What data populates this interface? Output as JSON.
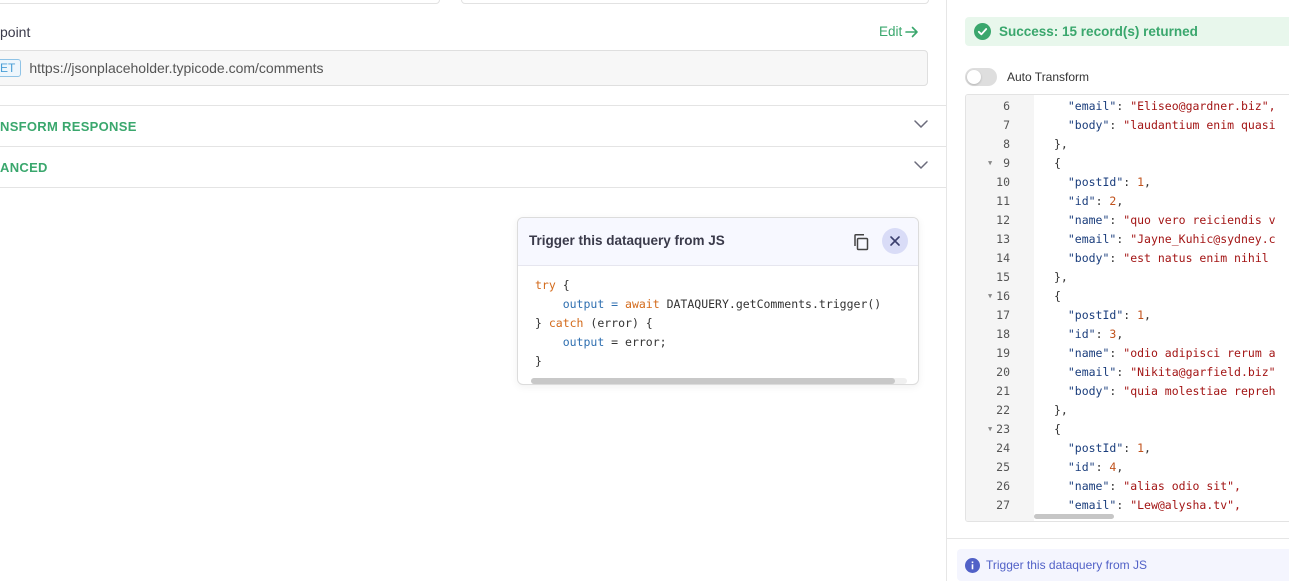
{
  "endpoint": {
    "label": "point",
    "edit_label": "Edit",
    "method": "ET",
    "url": "https://jsonplaceholder.typicode.com/comments"
  },
  "sections": [
    {
      "title": "NSFORM RESPONSE"
    },
    {
      "title": "ANCED"
    }
  ],
  "popup": {
    "title": "Trigger this dataquery from JS",
    "code": {
      "l1_kw": "try",
      "l1_rest": " {",
      "l2_var": "output",
      "l2_eq": " = ",
      "l2_kw": "await",
      "l2_rest": " DATAQUERY.getComments.trigger()",
      "l3_open": "} ",
      "l3_kw": "catch",
      "l3_rest": " (error) {",
      "l4_var": "output",
      "l4_rest": " = error;",
      "l5": "}"
    }
  },
  "result": {
    "status": "Success: 15 record(s) returned",
    "auto_transform_label": "Auto Transform",
    "auto_transform_on": false,
    "info_text": "Trigger this dataquery from JS"
  },
  "editor_lines": [
    {
      "n": "6",
      "fold": false,
      "indent": "  ",
      "key": "\"email\"",
      "sep": ": ",
      "val": "\"Eliseo@gardner.biz\",",
      "vt": "s"
    },
    {
      "n": "7",
      "fold": false,
      "indent": "  ",
      "key": "\"body\"",
      "sep": ": ",
      "val": "\"laudantium enim quasi",
      "vt": "s"
    },
    {
      "n": "8",
      "fold": false,
      "indent": "",
      "key": "",
      "sep": "",
      "val": "},",
      "vt": "p"
    },
    {
      "n": "9",
      "fold": true,
      "indent": "",
      "key": "",
      "sep": "",
      "val": "{",
      "vt": "p"
    },
    {
      "n": "10",
      "fold": false,
      "indent": "  ",
      "key": "\"postId\"",
      "sep": ": ",
      "val": "1",
      "tail": ",",
      "vt": "n"
    },
    {
      "n": "11",
      "fold": false,
      "indent": "  ",
      "key": "\"id\"",
      "sep": ": ",
      "val": "2",
      "tail": ",",
      "vt": "n"
    },
    {
      "n": "12",
      "fold": false,
      "indent": "  ",
      "key": "\"name\"",
      "sep": ": ",
      "val": "\"quo vero reiciendis v",
      "vt": "s"
    },
    {
      "n": "13",
      "fold": false,
      "indent": "  ",
      "key": "\"email\"",
      "sep": ": ",
      "val": "\"Jayne_Kuhic@sydney.c",
      "vt": "s"
    },
    {
      "n": "14",
      "fold": false,
      "indent": "  ",
      "key": "\"body\"",
      "sep": ": ",
      "val": "\"est natus enim nihil",
      "vt": "s"
    },
    {
      "n": "15",
      "fold": false,
      "indent": "",
      "key": "",
      "sep": "",
      "val": "},",
      "vt": "p"
    },
    {
      "n": "16",
      "fold": true,
      "indent": "",
      "key": "",
      "sep": "",
      "val": "{",
      "vt": "p"
    },
    {
      "n": "17",
      "fold": false,
      "indent": "  ",
      "key": "\"postId\"",
      "sep": ": ",
      "val": "1",
      "tail": ",",
      "vt": "n"
    },
    {
      "n": "18",
      "fold": false,
      "indent": "  ",
      "key": "\"id\"",
      "sep": ": ",
      "val": "3",
      "tail": ",",
      "vt": "n"
    },
    {
      "n": "19",
      "fold": false,
      "indent": "  ",
      "key": "\"name\"",
      "sep": ": ",
      "val": "\"odio adipisci rerum a",
      "vt": "s"
    },
    {
      "n": "20",
      "fold": false,
      "indent": "  ",
      "key": "\"email\"",
      "sep": ": ",
      "val": "\"Nikita@garfield.biz\"",
      "vt": "s"
    },
    {
      "n": "21",
      "fold": false,
      "indent": "  ",
      "key": "\"body\"",
      "sep": ": ",
      "val": "\"quia molestiae repreh",
      "vt": "s"
    },
    {
      "n": "22",
      "fold": false,
      "indent": "",
      "key": "",
      "sep": "",
      "val": "},",
      "vt": "p"
    },
    {
      "n": "23",
      "fold": true,
      "indent": "",
      "key": "",
      "sep": "",
      "val": "{",
      "vt": "p"
    },
    {
      "n": "24",
      "fold": false,
      "indent": "  ",
      "key": "\"postId\"",
      "sep": ": ",
      "val": "1",
      "tail": ",",
      "vt": "n"
    },
    {
      "n": "25",
      "fold": false,
      "indent": "  ",
      "key": "\"id\"",
      "sep": ": ",
      "val": "4",
      "tail": ",",
      "vt": "n"
    },
    {
      "n": "26",
      "fold": false,
      "indent": "  ",
      "key": "\"name\"",
      "sep": ": ",
      "val": "\"alias odio sit\",",
      "vt": "s"
    },
    {
      "n": "27",
      "fold": false,
      "indent": "  ",
      "key": "\"email\"",
      "sep": ": ",
      "val": "\"Lew@alysha.tv\",",
      "vt": "s"
    }
  ],
  "colors": {
    "accent_green": "#3aa76d",
    "info_blue": "#5161c7",
    "method_blue": "#4a9fd6"
  }
}
